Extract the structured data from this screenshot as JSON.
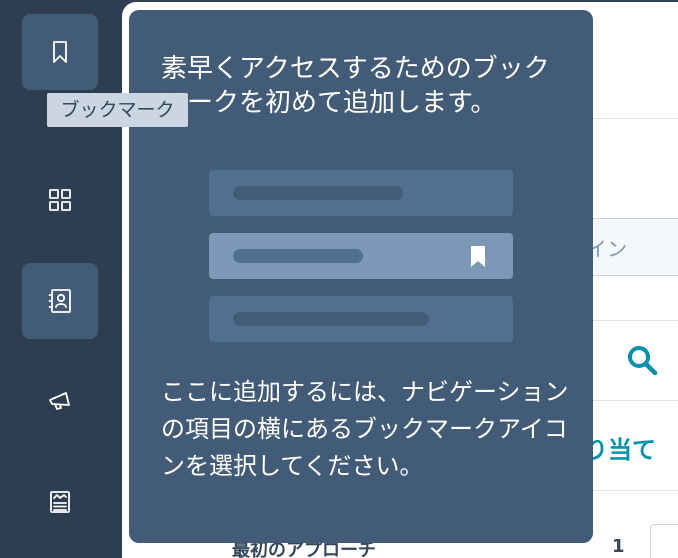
{
  "nav": {
    "bookmark_tooltip": "ブックマーク",
    "items": [
      {
        "icon": "bookmark-icon",
        "active": true
      },
      {
        "icon": "grid-icon",
        "active": false
      },
      {
        "icon": "contacts-icon",
        "active": true
      },
      {
        "icon": "megaphone-icon",
        "active": false
      },
      {
        "icon": "content-icon",
        "active": false
      }
    ]
  },
  "popover": {
    "title": "素早くアクセスするためのブックマークを初めて追加します。",
    "body": "ここに追加するには、ナビゲーションの項目の横にあるブックマークアイコンを選択してください。",
    "illustration_icon": "bookmark-flag-icon"
  },
  "background": {
    "partial_text_1": "イン",
    "partial_link": "り当て",
    "partial_bottom_label": "最初のアプローチ",
    "partial_count": "1",
    "search_icon": "search-icon"
  },
  "colors": {
    "rail": "#2d3e50",
    "popover": "#425b76",
    "rail_active": "#425b76",
    "link": "#0091ae",
    "tooltip": "#cbd6e2"
  }
}
